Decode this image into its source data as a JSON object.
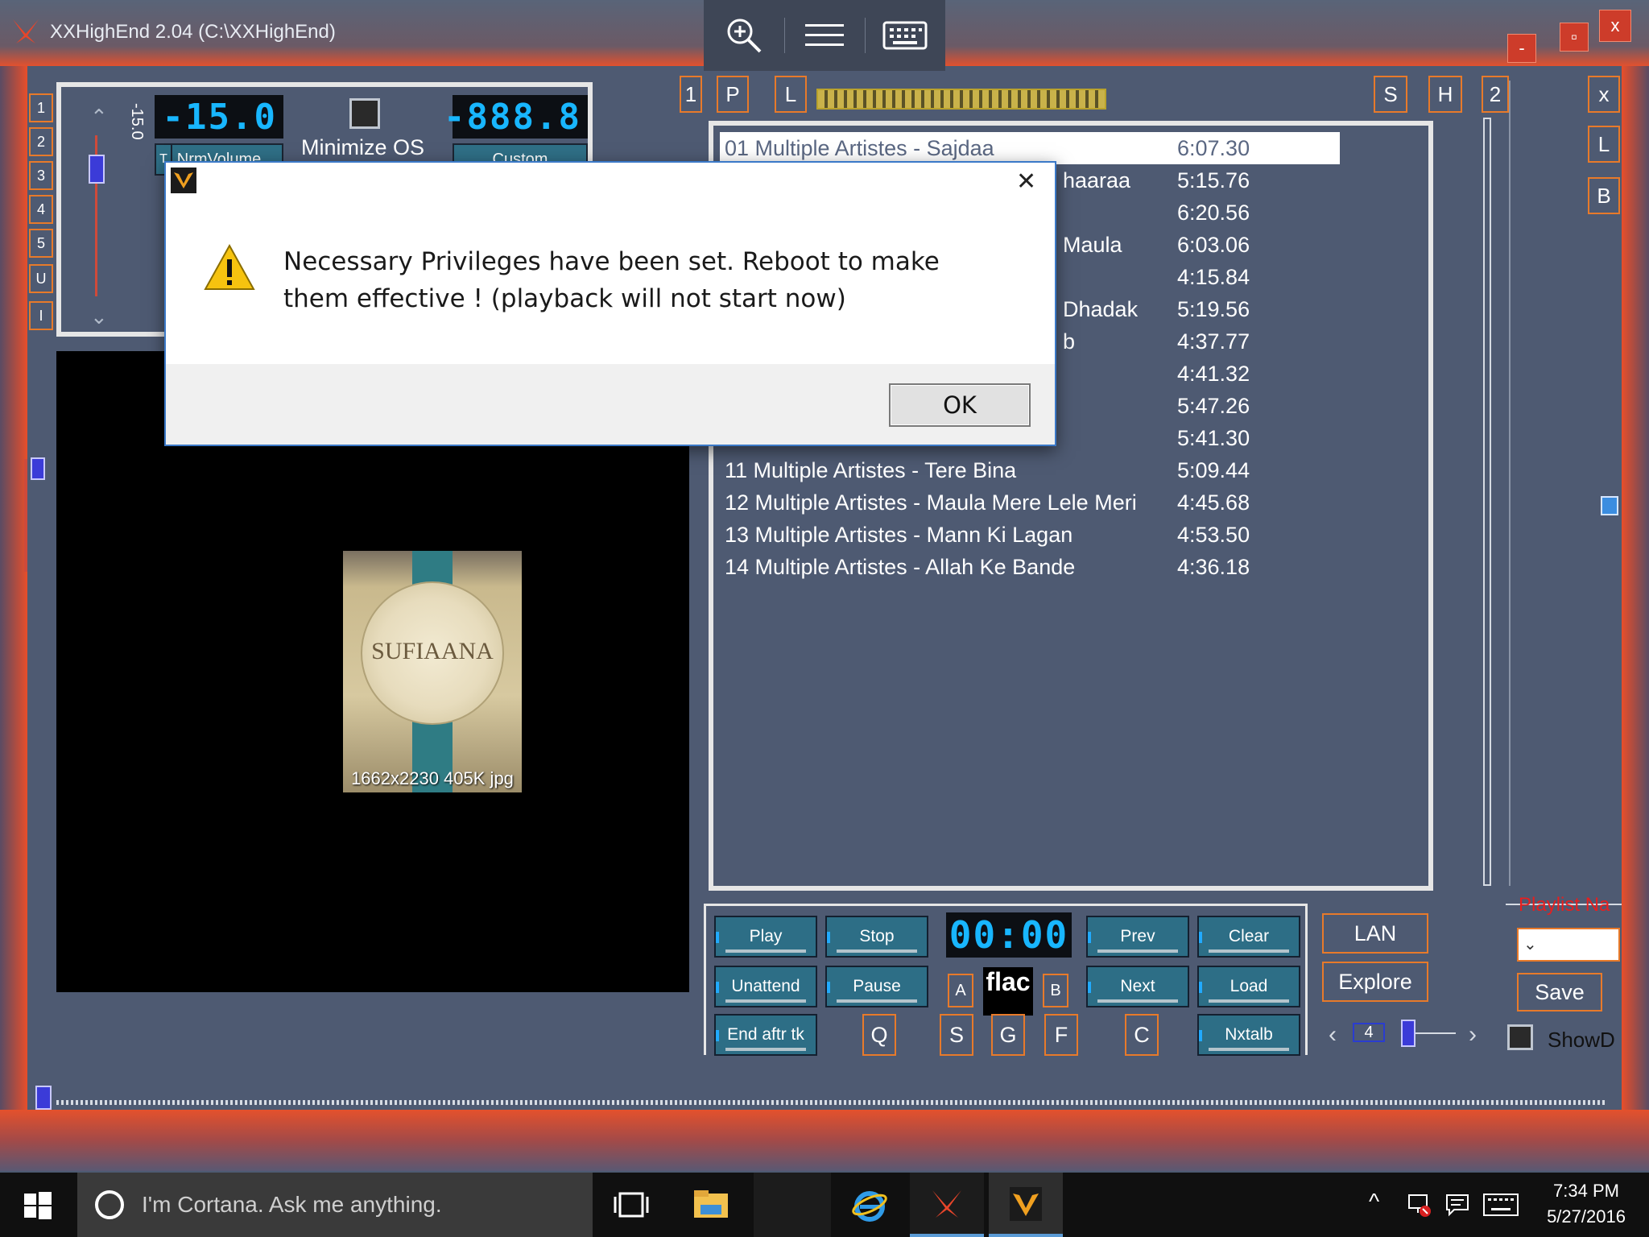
{
  "window": {
    "title": "XXHighEnd 2.04 (C:\\XXHighEnd)",
    "controls": {
      "minimize": "-",
      "restore": "▫",
      "close": "x"
    }
  },
  "left_tabs": [
    "1",
    "2",
    "3",
    "4",
    "5",
    "U",
    "I"
  ],
  "volume_panel": {
    "slider_value": "-15.0",
    "lcd_left": "-15.0",
    "lcd_right": "-888.8",
    "minimize_os_label": "Minimize OS",
    "nrm_volume_label": "NrmVolume",
    "custom_label": "Custom",
    "t_label": "T"
  },
  "playlist_tabs": {
    "num": "1",
    "p": "P",
    "l": "L",
    "s": "S",
    "h": "H",
    "num2": "2"
  },
  "right_side_tabs": [
    "x",
    "L",
    "B"
  ],
  "playlist": [
    {
      "title": "01 Multiple Artistes - Sajdaa",
      "duration": "6:07.30",
      "selected": true
    },
    {
      "title": "haaraa",
      "duration": "5:15.76"
    },
    {
      "title": "",
      "duration": "6:20.56"
    },
    {
      "title": "Maula",
      "duration": "6:03.06"
    },
    {
      "title": "",
      "duration": "4:15.84"
    },
    {
      "title": "Dhadak",
      "duration": "5:19.56"
    },
    {
      "title": "b",
      "duration": "4:37.77"
    },
    {
      "title": "",
      "duration": "4:41.32"
    },
    {
      "title": "",
      "duration": "5:47.26"
    },
    {
      "title": "",
      "duration": "5:41.30"
    },
    {
      "title": "11 Multiple Artistes - Tere Bina",
      "duration": "5:09.44"
    },
    {
      "title": "12 Multiple Artistes - Maula Mere Lele Meri",
      "duration": "4:45.68"
    },
    {
      "title": "13 Multiple Artistes - Mann Ki Lagan",
      "duration": "4:53.50"
    },
    {
      "title": "14 Multiple Artistes - Allah Ke Bande",
      "duration": "4:36.18"
    }
  ],
  "cover": {
    "title": "SUFIAANA",
    "info": "1662x2230 405K jpg"
  },
  "transport": {
    "play": "Play",
    "stop": "Stop",
    "unattend": "Unattend",
    "pause": "Pause",
    "end_after_track": "End aftr tk",
    "prev": "Prev",
    "clear": "Clear",
    "next": "Next",
    "load": "Load",
    "nxtalb": "Nxtalb",
    "time": "00:00",
    "format": "flac",
    "a": "A",
    "b": "B",
    "q": "Q",
    "s": "S",
    "g": "G",
    "f": "F",
    "c": "C"
  },
  "right_panel": {
    "lan": "LAN",
    "explore": "Explore",
    "page": "4",
    "playlist_name_label": "Playlist Na",
    "save": "Save",
    "showd": "ShowD"
  },
  "dialog": {
    "message": "Necessary Privileges have been set. Reboot to make them effective ! (playback will not start now)",
    "ok": "OK",
    "close": "✕"
  },
  "taskbar": {
    "search_placeholder": "I'm Cortana. Ask me anything.",
    "time": "7:34 PM",
    "date": "5/27/2016"
  },
  "colors": {
    "accent_orange": "#e87a2a",
    "teal": "#2d6e86",
    "lcd_blue": "#18b6ff",
    "frame_red": "#e84e2a"
  }
}
